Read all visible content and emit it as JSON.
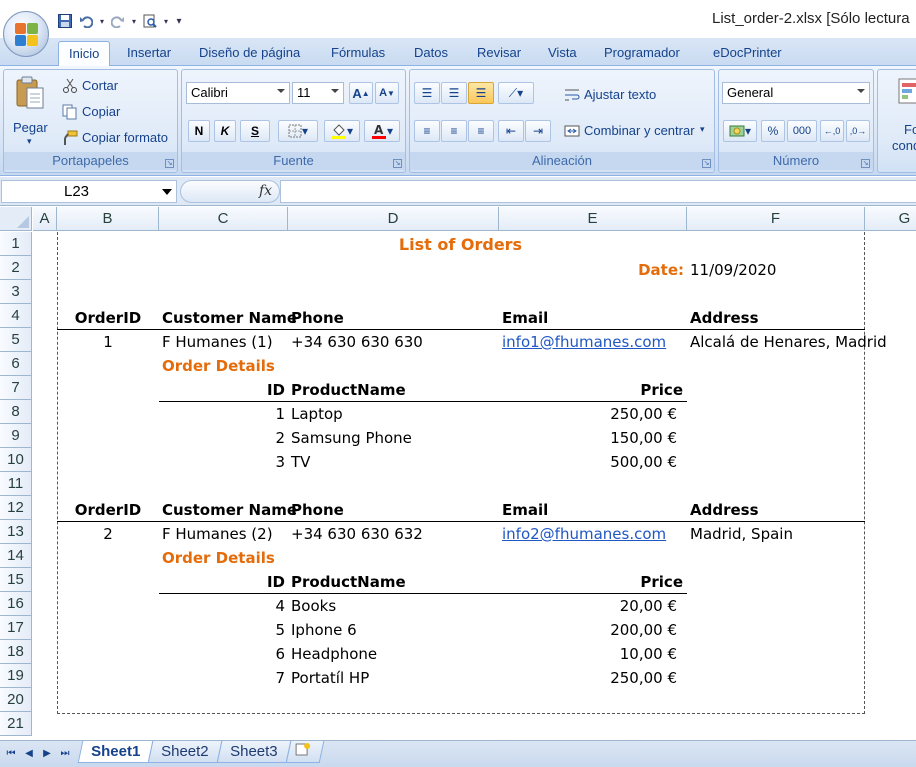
{
  "window": {
    "title": "List_order-2.xlsx  [Sólo lectura"
  },
  "ribbon_tabs": [
    "Inicio",
    "Insertar",
    "Diseño de página",
    "Fórmulas",
    "Datos",
    "Revisar",
    "Vista",
    "Programador",
    "eDocPrinter"
  ],
  "ribbon": {
    "clipboard": {
      "paste": "Pegar",
      "cut": "Cortar",
      "copy": "Copiar",
      "format_painter": "Copiar formato",
      "label": "Portapapeles"
    },
    "font": {
      "name": "Calibri",
      "size": "11",
      "bold": "N",
      "italic": "K",
      "underline": "S",
      "label": "Fuente"
    },
    "alignment": {
      "wrap": "Ajustar texto",
      "merge": "Combinar y centrar",
      "label": "Alineación"
    },
    "number": {
      "format": "General",
      "percent": "%",
      "thousands": "000",
      "label": "Número"
    },
    "styles": {
      "cond_format_1": "For",
      "cond_format_2": "condi"
    }
  },
  "formula_bar": {
    "cell_ref": "L23",
    "fx": "fx",
    "content": ""
  },
  "columns": [
    "A",
    "B",
    "C",
    "D",
    "E",
    "F",
    "G"
  ],
  "rows": [
    "1",
    "2",
    "3",
    "4",
    "5",
    "6",
    "7",
    "8",
    "9",
    "10",
    "11",
    "12",
    "13",
    "14",
    "15",
    "16",
    "17",
    "18",
    "19",
    "20",
    "21"
  ],
  "sheet": {
    "title": "List of Orders",
    "date_label": "Date:",
    "date_value": "11/09/2020",
    "headers": {
      "order_id": "OrderID",
      "customer": "Customer Name",
      "phone": "Phone",
      "email": "Email",
      "address": "Address"
    },
    "details_label": "Order Details",
    "detail_headers": {
      "id": "ID",
      "product": "ProductName",
      "price": "Price"
    },
    "orders": [
      {
        "order_id": "1",
        "customer": "F Humanes (1)",
        "phone": "+34 630 630 630",
        "email": "info1@fhumanes.com",
        "address": "Alcalá de Henares, Madrid",
        "items": [
          {
            "id": "1",
            "product": "Laptop",
            "price": "250,00 €"
          },
          {
            "id": "2",
            "product": "Samsung Phone",
            "price": "150,00 €"
          },
          {
            "id": "3",
            "product": "TV",
            "price": "500,00 €"
          }
        ]
      },
      {
        "order_id": "2",
        "customer": "F Humanes (2)",
        "phone": "+34 630 630 632",
        "email": "info2@fhumanes.com",
        "address": "Madrid, Spain",
        "items": [
          {
            "id": "4",
            "product": "Books",
            "price": "20,00 €"
          },
          {
            "id": "5",
            "product": "Iphone 6",
            "price": "200,00 €"
          },
          {
            "id": "6",
            "product": "Headphone",
            "price": "10,00 €"
          },
          {
            "id": "7",
            "product": "Portatíl HP",
            "price": "250,00 €"
          }
        ]
      }
    ]
  },
  "sheet_tabs": [
    "Sheet1",
    "Sheet2",
    "Sheet3"
  ],
  "colors": {
    "accent_orange": "#e46c0a",
    "link_blue": "#1f57c3",
    "ribbon_text": "#15428b"
  }
}
